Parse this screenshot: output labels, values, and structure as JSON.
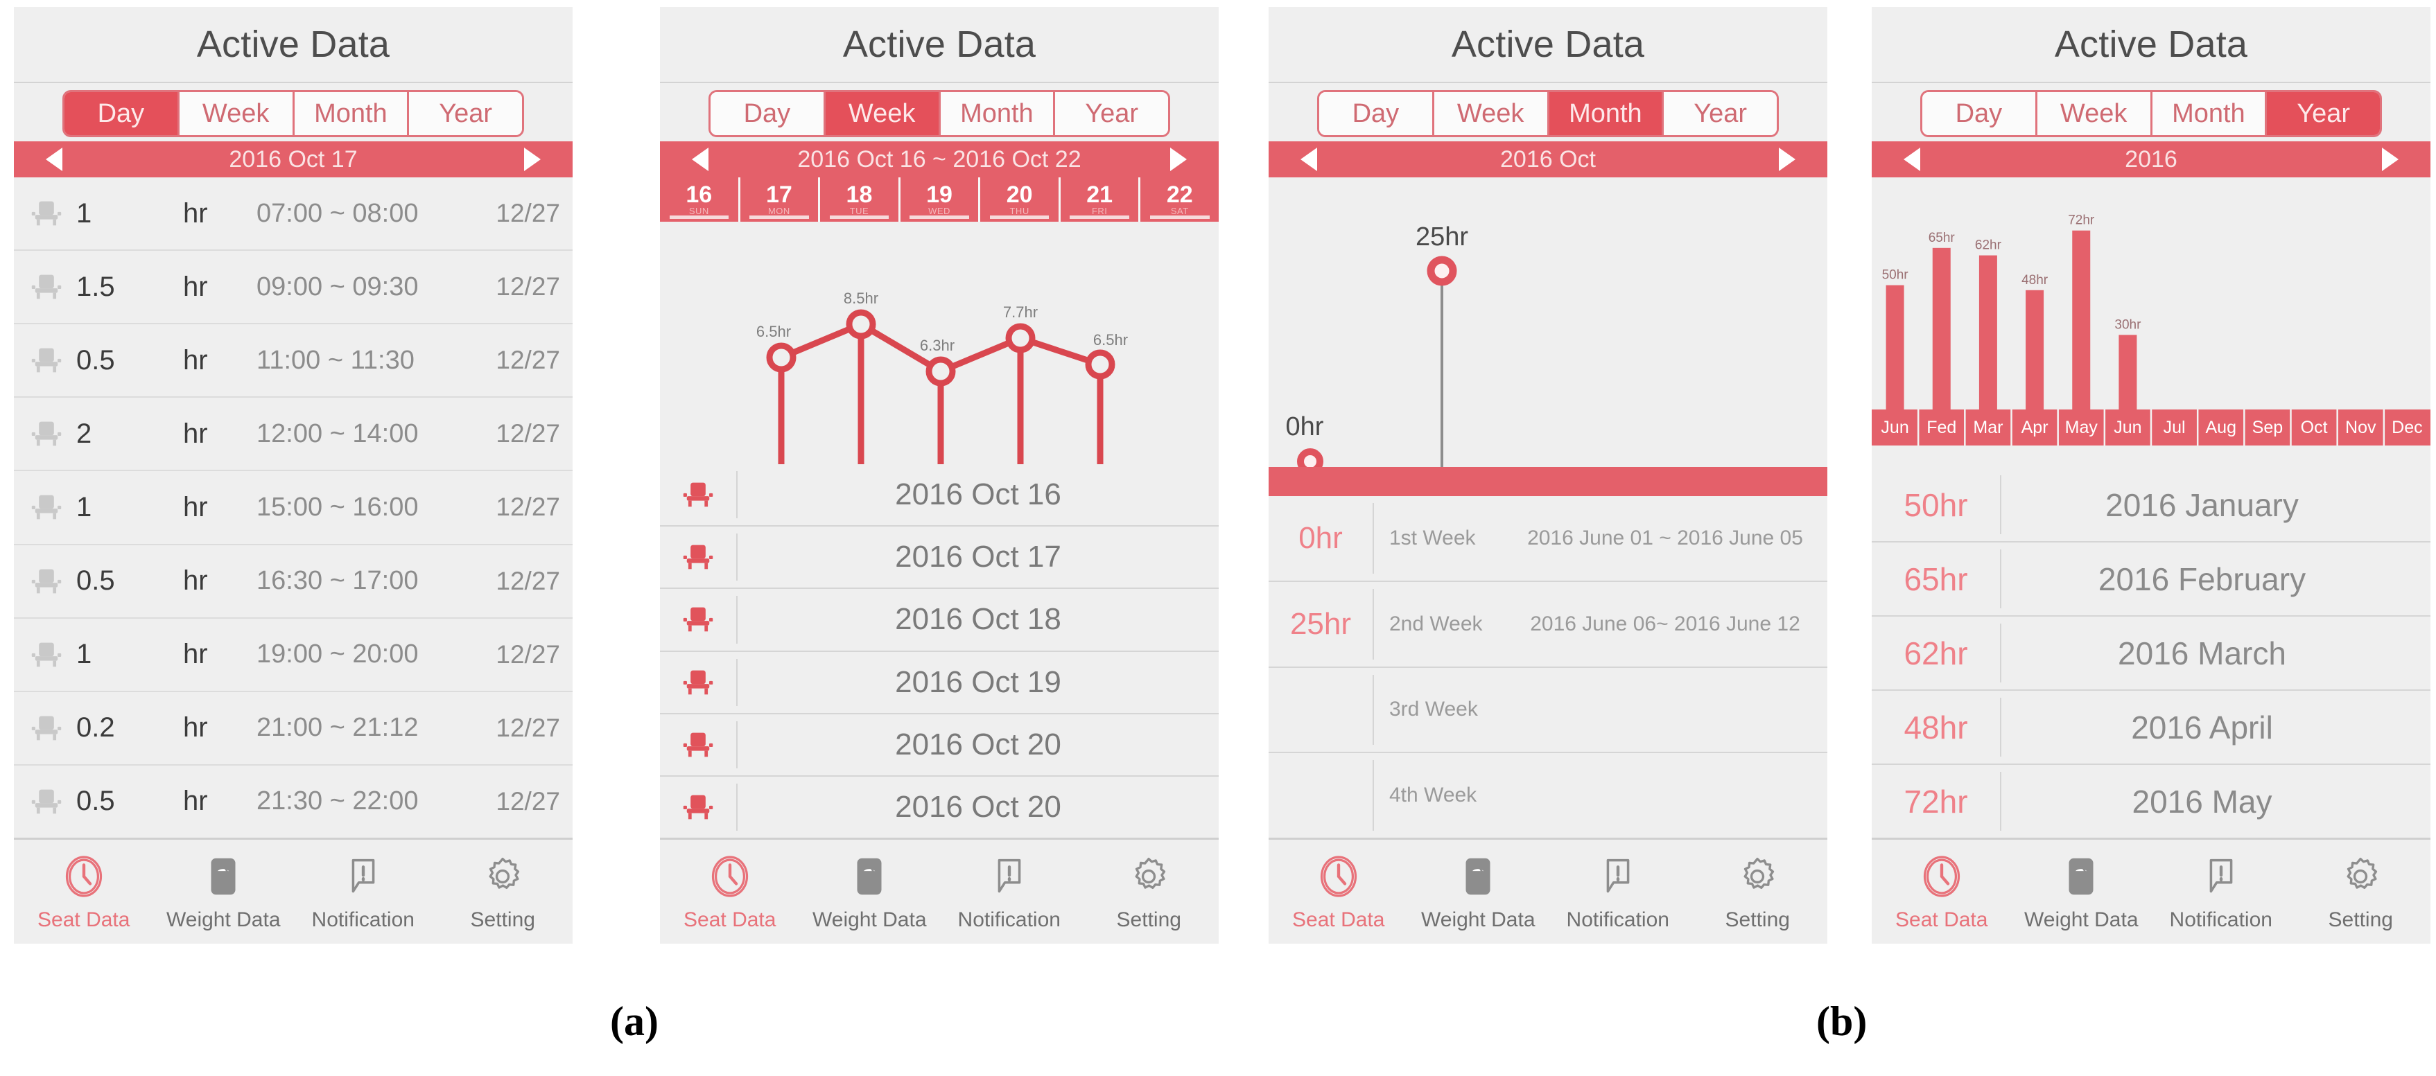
{
  "app": {
    "title": "Active Data",
    "accent": "#e4505a",
    "accent_soft": "#e4606a",
    "bg": "#efefef",
    "text_gray": "#8c8c8c"
  },
  "tabs": [
    "Day",
    "Week",
    "Month",
    "Year"
  ],
  "nav": [
    {
      "label": "Seat Data",
      "icon": "clock-icon"
    },
    {
      "label": "Weight Data",
      "icon": "scale-icon"
    },
    {
      "label": "Notification",
      "icon": "speech-bubble-icon"
    },
    {
      "label": "Setting",
      "icon": "gear-icon"
    }
  ],
  "panels": [
    {
      "id": "day",
      "title": "Active Data",
      "active_tab": "Day",
      "date_label": "2016 Oct 17",
      "rows": [
        {
          "duration": "1",
          "unit": "hr",
          "range": "07:00 ~ 08:00",
          "date": "12/27"
        },
        {
          "duration": "1.5",
          "unit": "hr",
          "range": "09:00 ~ 09:30",
          "date": "12/27"
        },
        {
          "duration": "0.5",
          "unit": "hr",
          "range": "11:00 ~ 11:30",
          "date": "12/27"
        },
        {
          "duration": "2",
          "unit": "hr",
          "range": "12:00 ~ 14:00",
          "date": "12/27"
        },
        {
          "duration": "1",
          "unit": "hr",
          "range": "15:00 ~ 16:00",
          "date": "12/27"
        },
        {
          "duration": "0.5",
          "unit": "hr",
          "range": "16:30 ~ 17:00",
          "date": "12/27"
        },
        {
          "duration": "1",
          "unit": "hr",
          "range": "19:00 ~ 20:00",
          "date": "12/27"
        },
        {
          "duration": "0.2",
          "unit": "hr",
          "range": "21:00 ~ 21:12",
          "date": "12/27"
        },
        {
          "duration": "0.5",
          "unit": "hr",
          "range": "21:30 ~ 22:00",
          "date": "12/27"
        }
      ]
    },
    {
      "id": "week",
      "title": "Active Data",
      "active_tab": "Week",
      "date_label": "2016 Oct 16 ~ 2016 Oct 22",
      "days": [
        {
          "num": "16",
          "dow": "SUN"
        },
        {
          "num": "17",
          "dow": "MON"
        },
        {
          "num": "18",
          "dow": "TUE"
        },
        {
          "num": "19",
          "dow": "WED"
        },
        {
          "num": "20",
          "dow": "THU"
        },
        {
          "num": "21",
          "dow": "FRI"
        },
        {
          "num": "22",
          "dow": "SAT"
        }
      ],
      "list": [
        "2016 Oct 16",
        "2016 Oct 17",
        "2016 Oct 18",
        "2016 Oct 19",
        "2016 Oct 20",
        "2016 Oct 20"
      ]
    },
    {
      "id": "month",
      "title": "Active Data",
      "active_tab": "Month",
      "date_label": "2016 Oct",
      "weeks": [
        {
          "hours": "0hr",
          "week": "1st  Week",
          "range": "2016 June 01 ~ 2016 June 05"
        },
        {
          "hours": "25hr",
          "week": "2nd  Week",
          "range": "2016 June 06~ 2016 June 12"
        },
        {
          "hours": "",
          "week": "3rd  Week",
          "range": ""
        },
        {
          "hours": "",
          "week": "4th  Week",
          "range": ""
        }
      ]
    },
    {
      "id": "year",
      "title": "Active Data",
      "active_tab": "Year",
      "date_label": "2016",
      "months": [
        {
          "hours": "50hr",
          "label": "2016 January"
        },
        {
          "hours": "65hr",
          "label": "2016 February"
        },
        {
          "hours": "62hr",
          "label": "2016 March"
        },
        {
          "hours": "48hr",
          "label": "2016 April"
        },
        {
          "hours": "72hr",
          "label": "2016 May"
        }
      ]
    }
  ],
  "chart_data": [
    {
      "panel": "week",
      "type": "line",
      "title": "",
      "categories": [
        "16",
        "17",
        "18",
        "19",
        "20",
        "21",
        "22"
      ],
      "point_labels": [
        "6.5hr",
        "8.5hr",
        "6.3hr",
        "7.7hr",
        "6.5hr"
      ],
      "values": [
        6.5,
        8.5,
        6.3,
        7.7,
        6.5
      ],
      "x_positions": [
        1,
        2,
        3,
        4,
        5
      ],
      "ylabel": "hr",
      "xlabel": "",
      "ylim": [
        0,
        10
      ],
      "grid": false,
      "legend": "none",
      "color": "#d9474f"
    },
    {
      "panel": "month",
      "type": "line",
      "title": "",
      "categories": [
        "1st Week",
        "2nd Week",
        "3rd Week",
        "4th Week"
      ],
      "point_labels": [
        "0hr",
        "25hr"
      ],
      "values": [
        0,
        25
      ],
      "ylabel": "hr",
      "xlabel": "",
      "ylim": [
        0,
        30
      ],
      "grid": false,
      "legend": "none",
      "color": "#e4606a"
    },
    {
      "panel": "year",
      "type": "bar",
      "title": "",
      "categories": [
        "Jun",
        "Fed",
        "Mar",
        "Apr",
        "May",
        "Jun",
        "Jul",
        "Aug",
        "Sep",
        "Oct",
        "Nov",
        "Dec"
      ],
      "values": [
        50,
        65,
        62,
        48,
        72,
        30,
        0,
        0,
        0,
        0,
        0,
        0
      ],
      "bar_labels": [
        "50hr",
        "65hr",
        "62hr",
        "48hr",
        "72hr",
        "30hr",
        "",
        "",
        "",
        "",
        "",
        ""
      ],
      "ylabel": "hr",
      "xlabel": "",
      "ylim": [
        0,
        80
      ],
      "grid": false,
      "legend": "none",
      "color": "#e4606a"
    }
  ],
  "captions": {
    "a": "(a)",
    "b": "(b)"
  }
}
